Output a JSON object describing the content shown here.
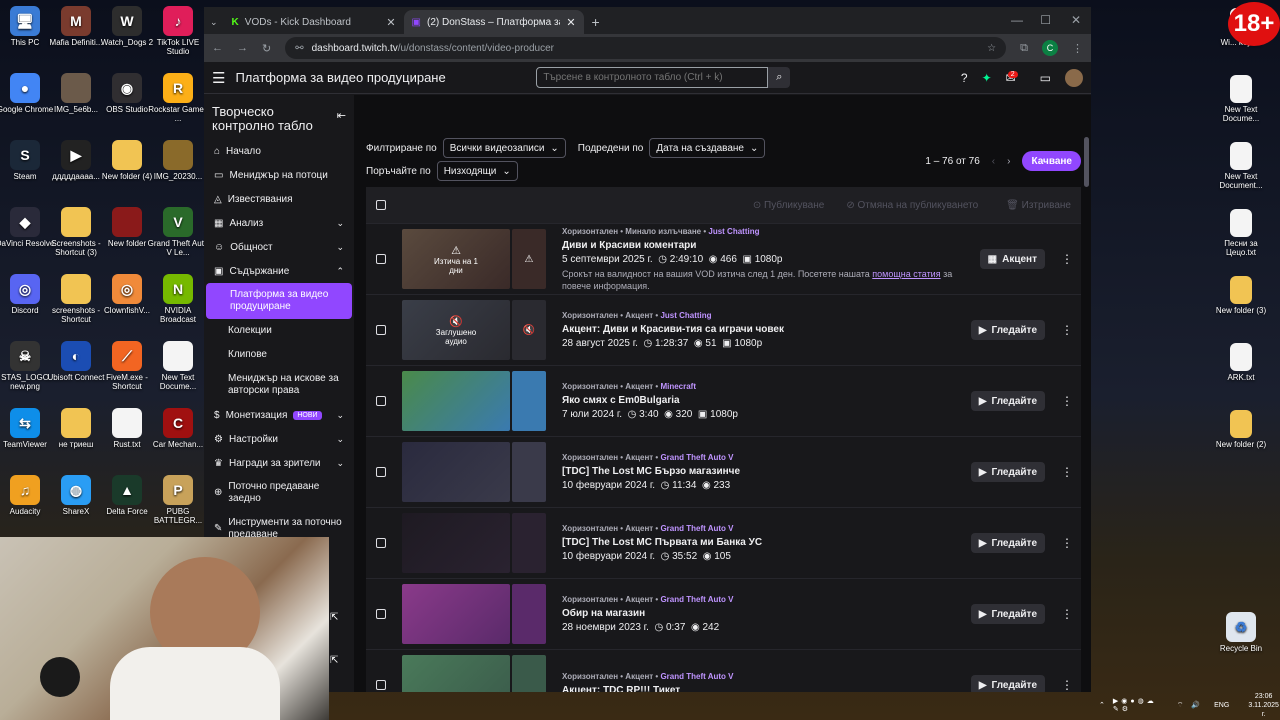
{
  "desktop_left": [
    {
      "label": "This PC",
      "color": "#3a7bd5",
      "glyph": "🖥"
    },
    {
      "label": "Mafia Definiti...",
      "color": "#7a3b2e",
      "glyph": "M"
    },
    {
      "label": "Watch_Dogs 2",
      "color": "#2d2d2d",
      "glyph": "W"
    },
    {
      "label": "TikTok LIVE Studio",
      "color": "#e01e5a",
      "glyph": "♪"
    },
    {
      "label": "Google Chrome",
      "color": "#4285f4",
      "glyph": "●"
    },
    {
      "label": "IMG_5e6b...",
      "color": "#6b5a4a",
      "glyph": ""
    },
    {
      "label": "OBS Studio",
      "color": "#302e31",
      "glyph": "◉"
    },
    {
      "label": "Rockstar Games ...",
      "color": "#fcaf17",
      "glyph": "R"
    },
    {
      "label": "Steam",
      "color": "#1b2838",
      "glyph": "S"
    },
    {
      "label": "дддддаааа...",
      "color": "#222",
      "glyph": "▶"
    },
    {
      "label": "New folder (4)",
      "color": "#f1c453",
      "glyph": ""
    },
    {
      "label": "IMG_20230...",
      "color": "#8a6a2a",
      "glyph": ""
    },
    {
      "label": "DaVinci Resolve",
      "color": "#2a2a3a",
      "glyph": "◆"
    },
    {
      "label": "Screenshots - Shortcut (3)",
      "color": "#f1c453",
      "glyph": ""
    },
    {
      "label": "New folder",
      "color": "#8a1a1a",
      "glyph": ""
    },
    {
      "label": "Grand Theft Auto V Le...",
      "color": "#2a6a2a",
      "glyph": "V"
    },
    {
      "label": "Discord",
      "color": "#5865f2",
      "glyph": "◎"
    },
    {
      "label": "screenshots - Shortcut",
      "color": "#f1c453",
      "glyph": ""
    },
    {
      "label": "ClownfishV...",
      "color": "#f08a3a",
      "glyph": "◎"
    },
    {
      "label": "NVIDIA Broadcast",
      "color": "#76b900",
      "glyph": "N"
    },
    {
      "label": "STAS_LOGO new.png",
      "color": "#333",
      "glyph": "☠"
    },
    {
      "label": "Ubisoft Connect",
      "color": "#1b4db3",
      "glyph": "◐"
    },
    {
      "label": "FiveM.exe - Shortcut",
      "color": "#f26522",
      "glyph": "⟋"
    },
    {
      "label": "New Text Docume...",
      "color": "#f4f4f4",
      "glyph": ""
    },
    {
      "label": "TeamViewer",
      "color": "#0e8ee9",
      "glyph": "⇆"
    },
    {
      "label": "не триеш",
      "color": "#f1c453",
      "glyph": ""
    },
    {
      "label": "Rust.txt",
      "color": "#f4f4f4",
      "glyph": ""
    },
    {
      "label": "Car Mechan...",
      "color": "#a01010",
      "glyph": "C"
    },
    {
      "label": "Audacity",
      "color": "#f0a020",
      "glyph": "♫"
    },
    {
      "label": "ShareX",
      "color": "#2a9df4",
      "glyph": "◍"
    },
    {
      "label": "Delta Force",
      "color": "#1a3a2a",
      "glyph": "▲"
    },
    {
      "label": "PUBG BATTLEGR...",
      "color": "#c8a25a",
      "glyph": "P"
    }
  ],
  "desktop_right": [
    {
      "label": "Wi... key.txt",
      "color": "#f4f4f4",
      "kind": "file"
    },
    {
      "label": "New Text Docume...",
      "color": "#f4f4f4",
      "kind": "file"
    },
    {
      "label": "New Text Document...",
      "color": "#f4f4f4",
      "kind": "file"
    },
    {
      "label": "Песни за Цецо.txt",
      "color": "#f4f4f4",
      "kind": "file"
    },
    {
      "label": "New folder (3)",
      "color": "#f1c453",
      "kind": "folder"
    },
    {
      "label": "ARK.txt",
      "color": "#f4f4f4",
      "kind": "file"
    },
    {
      "label": "New folder (2)",
      "color": "#f1c453",
      "kind": "folder"
    }
  ],
  "recycle_bin": "Recycle Bin",
  "age_badge": "18+",
  "browser": {
    "tabs": [
      {
        "label": "VODs - Kick Dashboard",
        "icon": "K",
        "icon_color": "#53fc18"
      },
      {
        "label": "(2) DonStass – Платформа за в",
        "icon": "▣",
        "icon_color": "#9147ff"
      }
    ],
    "new_tab": "+",
    "url_host": "dashboard.twitch.tv",
    "url_path": "/u/donstass/content/video-producer",
    "profile_initial": "C"
  },
  "topbar": {
    "title": "Платформа за видео продуциране",
    "search_placeholder": "Търсене в контролното табло (Ctrl + k)",
    "notifications": "2"
  },
  "sidebar": {
    "heading": "Творческо контролно табло",
    "items": [
      {
        "label": "Начало",
        "icon": "⌂",
        "chev": ""
      },
      {
        "label": "Мениджър на потоци",
        "icon": "▭",
        "chev": ""
      },
      {
        "label": "Известявания",
        "icon": "◬",
        "chev": ""
      },
      {
        "label": "Анализ",
        "icon": "▦",
        "chev": "⌄"
      },
      {
        "label": "Общност",
        "icon": "☺",
        "chev": "⌄"
      },
      {
        "label": "Съдържание",
        "icon": "▣",
        "chev": "⌃"
      }
    ],
    "sub_items": [
      "Платформа за видео продуциране",
      "Колекции",
      "Клипове",
      "Мениджър на искове за авторски права"
    ],
    "items2": [
      {
        "label": "Монетизация",
        "icon": "$",
        "badge": "НОВИ",
        "chev": "⌄"
      },
      {
        "label": "Настройки",
        "icon": "⚙",
        "badge": "",
        "chev": "⌄"
      },
      {
        "label": "Награди за зрители",
        "icon": "♛",
        "badge": "",
        "chev": "⌄"
      },
      {
        "label": "Поточно предаване заедно",
        "icon": "⊕",
        "badge": "",
        "chev": ""
      },
      {
        "label": "Инструменти за поточно предаване",
        "icon": "✎",
        "badge": "",
        "chev": ""
      }
    ]
  },
  "filters": {
    "filter_label": "Филтриране по",
    "filter_value": "Всички видеозаписи",
    "sort_label": "Подредени по",
    "sort_value": "Дата на създаване",
    "order_label": "Поръчайте по",
    "order_value": "Низходящи",
    "count": "1 – 76 от 76",
    "upload": "Качване"
  },
  "bulk": {
    "publish": "Публикуване",
    "unpublish": "Отмяна на публикуването",
    "delete": "Изтриване"
  },
  "videos": [
    {
      "meta": "Хоризонтален • Минало излъчване • ",
      "game": "Just Chatting",
      "title": "Диви и Красиви коментари",
      "date": "5 септември 2025 г.",
      "duration": "2:49:10",
      "views": "466",
      "quality": "1080p",
      "warning": "Срокът на валидност на вашия VOD изтича след 1 ден. Посетете нашата ",
      "link": "помощна статия",
      "warning2": " за повече информация.",
      "action": "Акцент",
      "action_icon": "▦",
      "overlay": "⚠\nИзтича на 1 дни",
      "c1": "#5a4a3e",
      "c2": "#3a2a28"
    },
    {
      "meta": "Хоризонтален • Акцент • ",
      "game": "Just Chatting",
      "title": "Акцент: Диви и Красиви-тия са играчи човек",
      "date": "28 август 2025 г.",
      "duration": "1:28:37",
      "views": "51",
      "quality": "1080p",
      "warning": "",
      "link": "",
      "warning2": "",
      "action": "Гледайте",
      "action_icon": "▶",
      "overlay": "🔇\nЗаглушено аудио",
      "c1": "#3a3e48",
      "c2": "#2a2a30"
    },
    {
      "meta": "Хоризонтален • Акцент • ",
      "game": "Minecraft",
      "title": "Яко смях с Em0Bulgaria",
      "date": "7 юли 2024 г.",
      "duration": "3:40",
      "views": "320",
      "quality": "1080p",
      "warning": "",
      "link": "",
      "warning2": "",
      "action": "Гледайте",
      "action_icon": "▶",
      "overlay": "",
      "c1": "#4a8a4a",
      "c2": "#3a7ab0"
    },
    {
      "meta": "Хоризонтален • Акцент • ",
      "game": "Grand Theft Auto V",
      "title": "[TDC] The Lost MC Бързо магазинче",
      "date": "10 февруари 2024 г.",
      "duration": "11:34",
      "views": "233",
      "quality": "",
      "warning": "",
      "link": "",
      "warning2": "",
      "action": "Гледайте",
      "action_icon": "▶",
      "overlay": "",
      "c1": "#2a2a3e",
      "c2": "#3a3a4a"
    },
    {
      "meta": "Хоризонтален • Акцент • ",
      "game": "Grand Theft Auto V",
      "title": "[TDC] The Lost MC Първата ми Банка УС",
      "date": "10 февруари 2024 г.",
      "duration": "35:52",
      "views": "105",
      "quality": "",
      "warning": "",
      "link": "",
      "warning2": "",
      "action": "Гледайте",
      "action_icon": "▶",
      "overlay": "",
      "c1": "#1e1a22",
      "c2": "#2a2230"
    },
    {
      "meta": "Хоризонтален • Акцент • ",
      "game": "Grand Theft Auto V",
      "title": "Обир на магазин",
      "date": "28 ноември 2023 г.",
      "duration": "0:37",
      "views": "242",
      "quality": "",
      "warning": "",
      "link": "",
      "warning2": "",
      "action": "Гледайте",
      "action_icon": "▶",
      "overlay": "",
      "c1": "#8a3a8a",
      "c2": "#5a2a6a"
    },
    {
      "meta": "Хоризонтален • Акцент • ",
      "game": "Grand Theft Auto V",
      "title": "Акцент: TDC RP!!! Тикет",
      "date": "",
      "duration": "",
      "views": "",
      "quality": "",
      "warning": "",
      "link": "",
      "warning2": "",
      "action": "Гледайте",
      "action_icon": "▶",
      "overlay": "",
      "c1": "#4a7a5a",
      "c2": "#3a5a4a"
    }
  ],
  "taskbar": {
    "lang": "ENG",
    "time": "23:06",
    "date": "3.11.2025 г."
  }
}
